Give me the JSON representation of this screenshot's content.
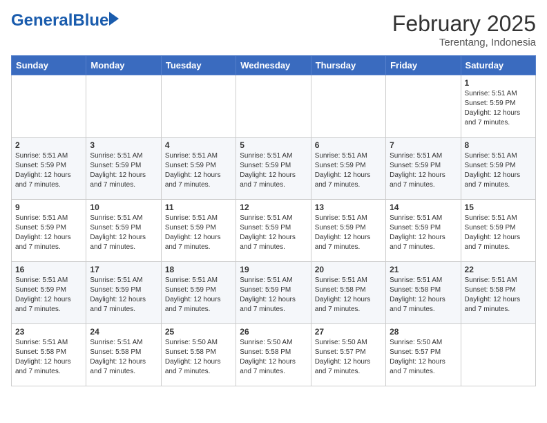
{
  "header": {
    "logo_general": "General",
    "logo_blue": "Blue",
    "month_title": "February 2025",
    "location": "Terentang, Indonesia"
  },
  "weekdays": [
    "Sunday",
    "Monday",
    "Tuesday",
    "Wednesday",
    "Thursday",
    "Friday",
    "Saturday"
  ],
  "weeks": [
    [
      {
        "day": "",
        "info": ""
      },
      {
        "day": "",
        "info": ""
      },
      {
        "day": "",
        "info": ""
      },
      {
        "day": "",
        "info": ""
      },
      {
        "day": "",
        "info": ""
      },
      {
        "day": "",
        "info": ""
      },
      {
        "day": "1",
        "info": "Sunrise: 5:51 AM\nSunset: 5:59 PM\nDaylight: 12 hours\nand 7 minutes."
      }
    ],
    [
      {
        "day": "2",
        "info": "Sunrise: 5:51 AM\nSunset: 5:59 PM\nDaylight: 12 hours\nand 7 minutes."
      },
      {
        "day": "3",
        "info": "Sunrise: 5:51 AM\nSunset: 5:59 PM\nDaylight: 12 hours\nand 7 minutes."
      },
      {
        "day": "4",
        "info": "Sunrise: 5:51 AM\nSunset: 5:59 PM\nDaylight: 12 hours\nand 7 minutes."
      },
      {
        "day": "5",
        "info": "Sunrise: 5:51 AM\nSunset: 5:59 PM\nDaylight: 12 hours\nand 7 minutes."
      },
      {
        "day": "6",
        "info": "Sunrise: 5:51 AM\nSunset: 5:59 PM\nDaylight: 12 hours\nand 7 minutes."
      },
      {
        "day": "7",
        "info": "Sunrise: 5:51 AM\nSunset: 5:59 PM\nDaylight: 12 hours\nand 7 minutes."
      },
      {
        "day": "8",
        "info": "Sunrise: 5:51 AM\nSunset: 5:59 PM\nDaylight: 12 hours\nand 7 minutes."
      }
    ],
    [
      {
        "day": "9",
        "info": "Sunrise: 5:51 AM\nSunset: 5:59 PM\nDaylight: 12 hours\nand 7 minutes."
      },
      {
        "day": "10",
        "info": "Sunrise: 5:51 AM\nSunset: 5:59 PM\nDaylight: 12 hours\nand 7 minutes."
      },
      {
        "day": "11",
        "info": "Sunrise: 5:51 AM\nSunset: 5:59 PM\nDaylight: 12 hours\nand 7 minutes."
      },
      {
        "day": "12",
        "info": "Sunrise: 5:51 AM\nSunset: 5:59 PM\nDaylight: 12 hours\nand 7 minutes."
      },
      {
        "day": "13",
        "info": "Sunrise: 5:51 AM\nSunset: 5:59 PM\nDaylight: 12 hours\nand 7 minutes."
      },
      {
        "day": "14",
        "info": "Sunrise: 5:51 AM\nSunset: 5:59 PM\nDaylight: 12 hours\nand 7 minutes."
      },
      {
        "day": "15",
        "info": "Sunrise: 5:51 AM\nSunset: 5:59 PM\nDaylight: 12 hours\nand 7 minutes."
      }
    ],
    [
      {
        "day": "16",
        "info": "Sunrise: 5:51 AM\nSunset: 5:59 PM\nDaylight: 12 hours\nand 7 minutes."
      },
      {
        "day": "17",
        "info": "Sunrise: 5:51 AM\nSunset: 5:59 PM\nDaylight: 12 hours\nand 7 minutes."
      },
      {
        "day": "18",
        "info": "Sunrise: 5:51 AM\nSunset: 5:59 PM\nDaylight: 12 hours\nand 7 minutes."
      },
      {
        "day": "19",
        "info": "Sunrise: 5:51 AM\nSunset: 5:59 PM\nDaylight: 12 hours\nand 7 minutes."
      },
      {
        "day": "20",
        "info": "Sunrise: 5:51 AM\nSunset: 5:58 PM\nDaylight: 12 hours\nand 7 minutes."
      },
      {
        "day": "21",
        "info": "Sunrise: 5:51 AM\nSunset: 5:58 PM\nDaylight: 12 hours\nand 7 minutes."
      },
      {
        "day": "22",
        "info": "Sunrise: 5:51 AM\nSunset: 5:58 PM\nDaylight: 12 hours\nand 7 minutes."
      }
    ],
    [
      {
        "day": "23",
        "info": "Sunrise: 5:51 AM\nSunset: 5:58 PM\nDaylight: 12 hours\nand 7 minutes."
      },
      {
        "day": "24",
        "info": "Sunrise: 5:51 AM\nSunset: 5:58 PM\nDaylight: 12 hours\nand 7 minutes."
      },
      {
        "day": "25",
        "info": "Sunrise: 5:50 AM\nSunset: 5:58 PM\nDaylight: 12 hours\nand 7 minutes."
      },
      {
        "day": "26",
        "info": "Sunrise: 5:50 AM\nSunset: 5:58 PM\nDaylight: 12 hours\nand 7 minutes."
      },
      {
        "day": "27",
        "info": "Sunrise: 5:50 AM\nSunset: 5:57 PM\nDaylight: 12 hours\nand 7 minutes."
      },
      {
        "day": "28",
        "info": "Sunrise: 5:50 AM\nSunset: 5:57 PM\nDaylight: 12 hours\nand 7 minutes."
      },
      {
        "day": "",
        "info": ""
      }
    ]
  ]
}
